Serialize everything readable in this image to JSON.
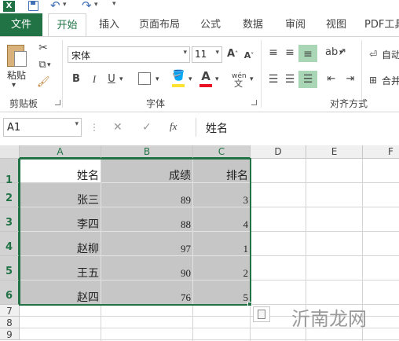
{
  "quick_access": {
    "app_icon": "excel-icon",
    "save_icon": "save-icon",
    "undo_icon": "undo-icon",
    "redo_icon": "redo-icon",
    "customize_icon": "customize-qat-icon"
  },
  "tabs": [
    {
      "label": "文件"
    },
    {
      "label": "开始"
    },
    {
      "label": "插入"
    },
    {
      "label": "页面布局"
    },
    {
      "label": "公式"
    },
    {
      "label": "数据"
    },
    {
      "label": "审阅"
    },
    {
      "label": "视图"
    },
    {
      "label": "PDF工具"
    }
  ],
  "ribbon": {
    "clipboard": {
      "paste_label": "粘贴",
      "group_label": "剪贴板"
    },
    "font": {
      "font_name": "宋体",
      "font_size": "11",
      "group_label": "字体",
      "bold": "B",
      "italic": "I",
      "underline": "U",
      "font_color_letter": "A",
      "phonetic": "wén"
    },
    "alignment": {
      "group_label": "对齐方式",
      "wrap_label": "自动",
      "merge_label": "合并",
      "fill_color": "#fde432",
      "font_color": "#e81123",
      "highlight_color": "#a9d7b5"
    }
  },
  "formula_bar": {
    "name_box": "A1",
    "fx": "fx",
    "value": "姓名"
  },
  "sheet": {
    "columns": [
      "A",
      "B",
      "C",
      "D",
      "E",
      "F"
    ],
    "rows": [
      "1",
      "2",
      "3",
      "4",
      "5",
      "6",
      "7",
      "8",
      "9"
    ],
    "header": [
      "姓名",
      "成绩",
      "排名"
    ],
    "records": [
      [
        "张三",
        "89",
        "3"
      ],
      [
        "李四",
        "88",
        "4"
      ],
      [
        "赵柳",
        "97",
        "1"
      ],
      [
        "王五",
        "90",
        "2"
      ],
      [
        "赵四",
        "76",
        "5"
      ]
    ]
  },
  "watermark": "沂南龙网",
  "colors": {
    "excel_green": "#217346",
    "selection_gray": "#c6c6c6"
  }
}
